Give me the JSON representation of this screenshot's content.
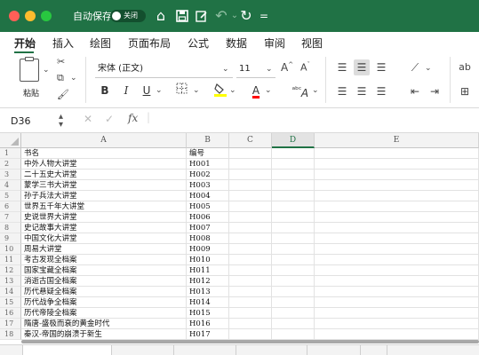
{
  "titlebar": {
    "autosave_label": "自动保存",
    "autosave_state": "关闭"
  },
  "tabs": [
    "开始",
    "插入",
    "绘图",
    "页面布局",
    "公式",
    "数据",
    "审阅",
    "视图"
  ],
  "ribbon": {
    "paste_label": "粘贴",
    "font_name": "宋体 (正文)",
    "font_size": "11",
    "bold": "B",
    "italic": "I",
    "underline": "U",
    "font_color_letter": "A",
    "grow_font": "A^",
    "shrink_font": "Aˇ",
    "phonetic": "ᵃᵇᶜ",
    "font_color_bar": "#ff0000",
    "highlight_bar": "#ffff00"
  },
  "formula_bar": {
    "cell_ref": "D36",
    "fx": "fx",
    "content": ""
  },
  "sheet": {
    "columns": [
      "A",
      "B",
      "C",
      "D",
      "E"
    ],
    "selected_column": "D",
    "rows": [
      {
        "num": "1",
        "a": "书名",
        "b": "编号"
      },
      {
        "num": "2",
        "a": "中外人物大讲堂",
        "b": "H001"
      },
      {
        "num": "3",
        "a": "二十五史大讲堂",
        "b": "H002"
      },
      {
        "num": "4",
        "a": "蒙学三书大讲堂",
        "b": "H003"
      },
      {
        "num": "5",
        "a": "孙子兵法大讲堂",
        "b": "H004"
      },
      {
        "num": "6",
        "a": "世界五千年大讲堂",
        "b": "H005"
      },
      {
        "num": "7",
        "a": "史说世界大讲堂",
        "b": "H006"
      },
      {
        "num": "8",
        "a": "史记故事大讲堂",
        "b": "H007"
      },
      {
        "num": "9",
        "a": "中国文化大讲堂",
        "b": "H008"
      },
      {
        "num": "10",
        "a": "周易大讲堂",
        "b": "H009"
      },
      {
        "num": "11",
        "a": "考古发现全档案",
        "b": "H010"
      },
      {
        "num": "12",
        "a": "国家宝藏全档案",
        "b": "H011"
      },
      {
        "num": "13",
        "a": "消逝古国全档案",
        "b": "H012"
      },
      {
        "num": "14",
        "a": "历代悬疑全档案",
        "b": "H013"
      },
      {
        "num": "15",
        "a": "历代战争全档案",
        "b": "H014"
      },
      {
        "num": "16",
        "a": "历代帝陵全档案",
        "b": "H015"
      },
      {
        "num": "17",
        "a": "隋唐-盛极而衰的黄金时代",
        "b": "H016"
      },
      {
        "num": "18",
        "a": "秦汉-帝国的崩溃于新生",
        "b": "H017"
      }
    ]
  },
  "sheet_tabs": [
    "",
    "",
    "",
    "",
    "",
    "",
    ""
  ],
  "accent": "#207245"
}
